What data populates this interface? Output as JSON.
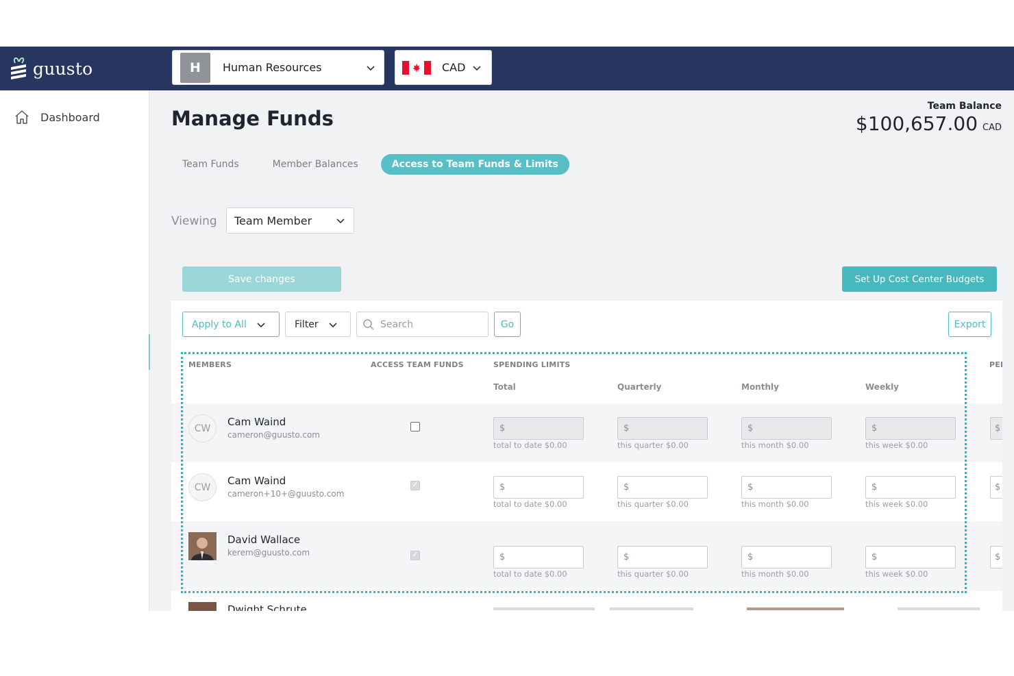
{
  "header": {
    "logo_text": "guusto",
    "department": {
      "avatar_letter": "H",
      "label": "Human Resources"
    },
    "currency": {
      "label": "CAD"
    }
  },
  "sidebar": {
    "items": [
      {
        "label": "Dashboard",
        "icon": "home-icon"
      }
    ]
  },
  "page": {
    "title": "Manage Funds",
    "team_balance_label": "Team Balance",
    "team_balance_amount": "$100,657.00",
    "team_balance_currency": "CAD"
  },
  "tabs": [
    {
      "label": "Team Funds",
      "active": false
    },
    {
      "label": "Member Balances",
      "active": false
    },
    {
      "label": "Access to Team Funds & Limits",
      "active": true
    }
  ],
  "viewing": {
    "label": "Viewing",
    "value": "Team Member"
  },
  "actions": {
    "save_label": "Save changes",
    "cost_center_label": "Set Up Cost Center Budgets"
  },
  "toolbar": {
    "apply_label": "Apply to All",
    "filter_label": "Filter",
    "search_placeholder": "Search",
    "go_label": "Go",
    "export_label": "Export"
  },
  "table": {
    "columns": {
      "members": "MEMBERS",
      "access": "ACCESS TEAM FUNDS",
      "limits": "SPENDING LIMITS",
      "per_cut": "PER"
    },
    "sub_columns": [
      "Total",
      "Quarterly",
      "Monthly",
      "Weekly"
    ],
    "currency_symbol": "$",
    "rows": [
      {
        "initials": "CW",
        "name": "Cam Waind",
        "email": "cameron@guusto.com",
        "access_checked": false,
        "inputs_disabled": true,
        "hints": [
          "total to date $0.00",
          "this quarter $0.00",
          "this month $0.00",
          "this week $0.00"
        ]
      },
      {
        "initials": "CW",
        "name": "Cam Waind",
        "email": "cameron+10+@guusto.com",
        "access_checked": true,
        "inputs_disabled": false,
        "hints": [
          "total to date $0.00",
          "this quarter $0.00",
          "this month $0.00",
          "this week $0.00"
        ]
      },
      {
        "initials": "",
        "name": "David Wallace",
        "email": "kerem@guusto.com",
        "access_checked": true,
        "inputs_disabled": false,
        "hints": [
          "total to date $0.00",
          "this quarter $0.00",
          "this month $0.00",
          "this week $0.00"
        ]
      }
    ],
    "partial_row_name": "Dwight Schrute"
  },
  "colors": {
    "header_bg": "#263660",
    "accent": "#57bfc5",
    "accent_dark": "#47b8be",
    "highlight_border": "#2fb7bf"
  }
}
